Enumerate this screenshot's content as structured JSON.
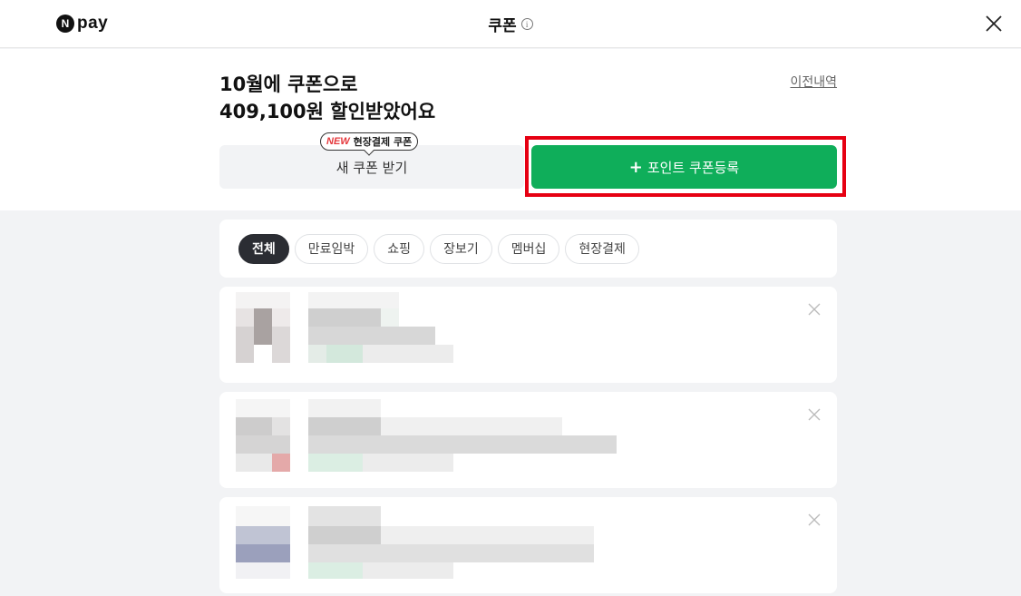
{
  "header": {
    "logo_badge": "N",
    "logo_text": "pay",
    "title": "쿠폰",
    "info_glyph": "i",
    "close_icon": "close-icon"
  },
  "hero": {
    "headline_line1": "10월에 쿠폰으로",
    "headline_line2": "409,100원 할인받았어요",
    "history_link": "이전내역",
    "receive_button": "새 쿠폰 받기",
    "badge_new": "NEW",
    "badge_text": "현장결제 쿠폰",
    "register_plus": "+",
    "register_button": "포인트 쿠폰등록"
  },
  "filters": [
    {
      "label": "전체",
      "active": true
    },
    {
      "label": "만료임박",
      "active": false
    },
    {
      "label": "쇼핑",
      "active": false
    },
    {
      "label": "장보기",
      "active": false
    },
    {
      "label": "멤버십",
      "active": false
    },
    {
      "label": "현장결제",
      "active": false
    }
  ],
  "colors": {
    "accent_green": "#0fae5a",
    "highlight_red": "#e60012",
    "chip_active": "#2b2d33",
    "background": "#f2f3f5"
  }
}
